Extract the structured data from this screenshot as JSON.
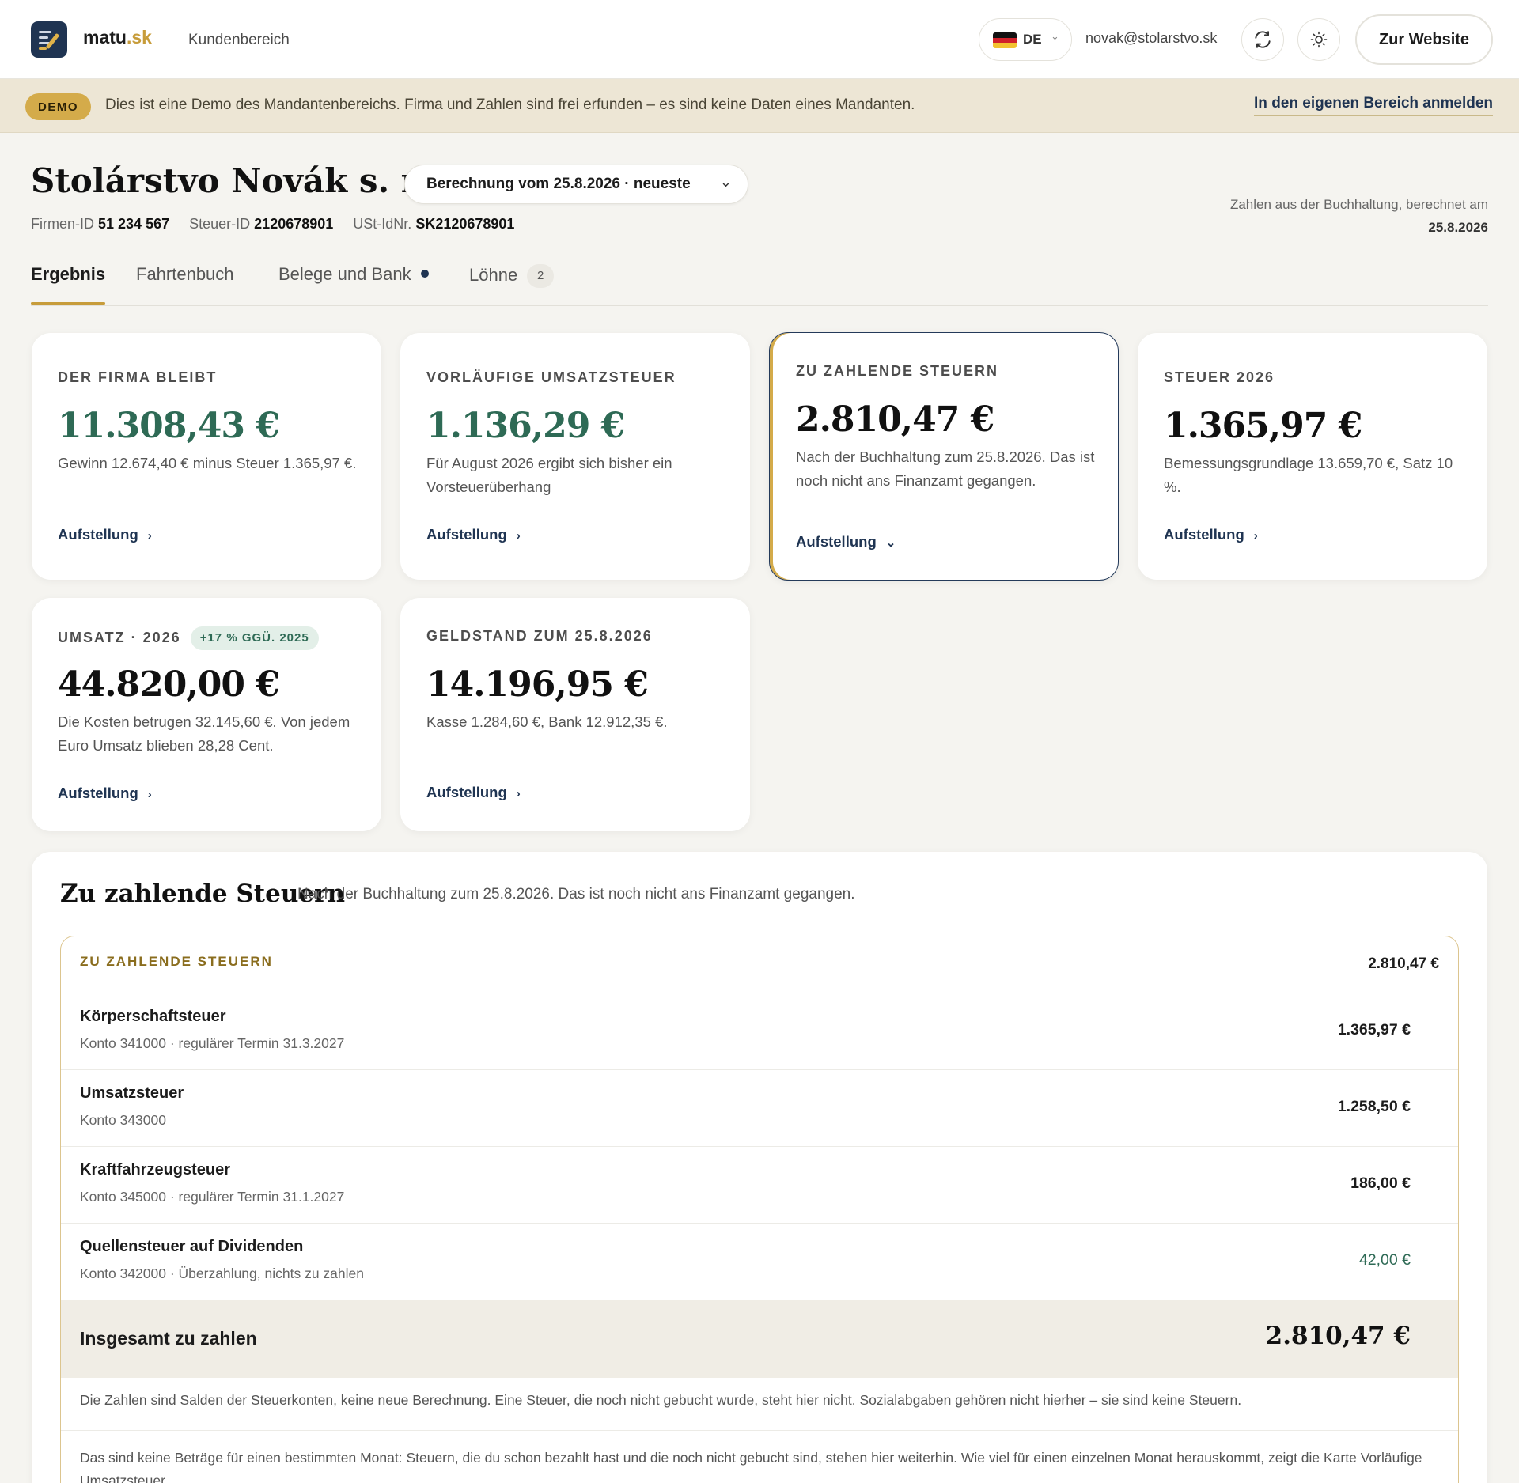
{
  "header": {
    "brand_main": "matu",
    "brand_tld": ".sk",
    "area": "Kundenbereich",
    "language": "DE",
    "email": "novak@stolarstvo.sk",
    "website_button": "Zur Website",
    "icons": [
      "refresh-icon",
      "sun-icon"
    ]
  },
  "demo": {
    "badge": "DEMO",
    "message": "Dies ist eine Demo des Mandantenbereichs. Firma und Zahlen sind frei erfunden – es sind keine Daten eines Mandanten.",
    "login_link": "In den eigenen Bereich anmelden"
  },
  "company": {
    "name": "Stolárstvo Novák s. r. o.",
    "calculation": "Berechnung vom 25.8.2026 · neueste",
    "firm_id_label": "Firmen-ID",
    "firm_id": "51 234 567",
    "tax_id_label": "Steuer-ID",
    "tax_id": "2120678901",
    "vat_id_label": "USt-IdNr.",
    "vat_id": "SK2120678901",
    "computed_label": "Zahlen aus der Buchhaltung, berechnet am",
    "computed_date": "25.8.2026"
  },
  "tabs": [
    {
      "label": "Ergebnis",
      "active": true
    },
    {
      "label": "Fahrtenbuch"
    },
    {
      "label": "Belege und Bank",
      "dot": true
    },
    {
      "label": "Löhne",
      "count": "2"
    }
  ],
  "cards": [
    {
      "key": "DER FIRMA BLEIBT",
      "value": "11.308,43 €",
      "desc": "Gewinn 12.674,40 € minus Steuer 1.365,97 €.",
      "link": "Aufstellung"
    },
    {
      "key": "VORLÄUFIGE UMSATZSTEUER",
      "value": "1.136,29 €",
      "desc": "Für August 2026 ergibt sich bisher ein Vorsteuerüberhang",
      "link": "Aufstellung"
    },
    {
      "key": "ZU ZAHLENDE STEUERN",
      "value": "2.810,47 €",
      "desc": "Nach der Buchhaltung zum 25.8.2026. Das ist noch nicht ans Finanzamt gegangen.",
      "link": "Aufstellung"
    },
    {
      "key": "STEUER 2026",
      "value": "1.365,97 €",
      "desc": "Bemessungsgrundlage 13.659,70 €, Satz 10 %.",
      "link": "Aufstellung"
    },
    {
      "key": "UMSATZ · 2026",
      "trend": "+17 % GGÜ. 2025",
      "value": "44.820,00 €",
      "desc": "Die Kosten betrugen 32.145,60 €. Von jedem Euro Umsatz blieben 28,28 Cent.",
      "link": "Aufstellung"
    },
    {
      "key": "GELDSTAND ZUM 25.8.2026",
      "value": "14.196,95 €",
      "desc": "Kasse 1.284,60 €, Bank 12.912,35 €.",
      "link": "Aufstellung"
    }
  ],
  "section": {
    "title": "Zu zahlende Steuern",
    "subtitle": "Nach der Buchhaltung zum 25.8.2026. Das ist noch nicht ans Finanzamt gegangen.",
    "table_header": "ZU ZAHLENDE STEUERN",
    "table_header_value": "2.810,47 €",
    "rows": [
      {
        "name": "Körperschaftsteuer",
        "meta": "Konto 341000 · regulärer Termin 31.3.2027",
        "amount": "1.365,97 €"
      },
      {
        "name": "Umsatzsteuer",
        "meta": "Konto 343000",
        "amount": "1.258,50 €"
      },
      {
        "name": "Kraftfahrzeugsteuer",
        "meta": "Konto 345000 · regulärer Termin 31.1.2027",
        "amount": "186,00 €"
      },
      {
        "name": "Quellensteuer auf Dividenden",
        "meta": "Konto 342000 · Überzahlung, nichts zu zahlen",
        "amount": "42,00 €"
      }
    ],
    "total_label": "Insgesamt zu zahlen",
    "total_value": "2.810,47 €",
    "note1": "Die Zahlen sind Salden der Steuerkonten, keine neue Berechnung. Eine Steuer, die noch nicht gebucht wurde, steht hier nicht. Sozialabgaben gehören nicht hierher – sie sind keine Steuern.",
    "note2": "Das sind keine Beträge für einen bestimmten Monat: Steuern, die du schon bezahlt hast und die noch nicht gebucht sind, stehen hier weiterhin. Wie viel für einen einzelnen Monat herauskommt, zeigt die Karte Vorläufige Umsatzsteuer."
  },
  "colors": {
    "accent_gold": "#c79c3a",
    "navy": "#1f3452",
    "positive_green": "#2e6a55"
  }
}
